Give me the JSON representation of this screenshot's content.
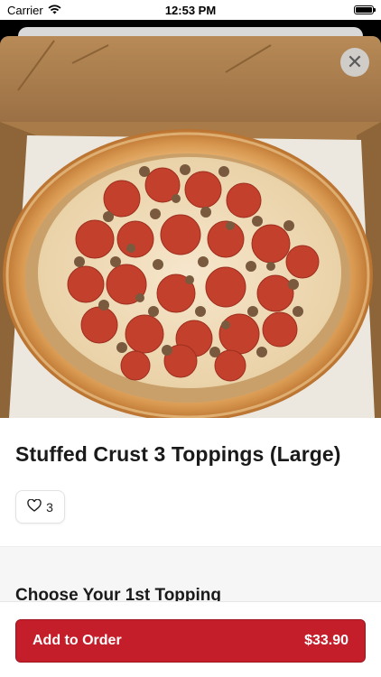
{
  "status_bar": {
    "carrier": "Carrier",
    "time": "12:53 PM",
    "icons": [
      "wifi-icon",
      "battery-icon"
    ]
  },
  "item": {
    "title": "Stuffed Crust 3 Toppings (Large)",
    "favorite_count": "3",
    "image_alt": "stuffed crust pizza with pepperoni and sausage in a box"
  },
  "section": {
    "title": "Choose Your 1st Topping"
  },
  "footer": {
    "add_label": "Add to Order",
    "price": "$33.90"
  },
  "colors": {
    "accent": "#c41e2a"
  },
  "close_icon": "close-icon"
}
